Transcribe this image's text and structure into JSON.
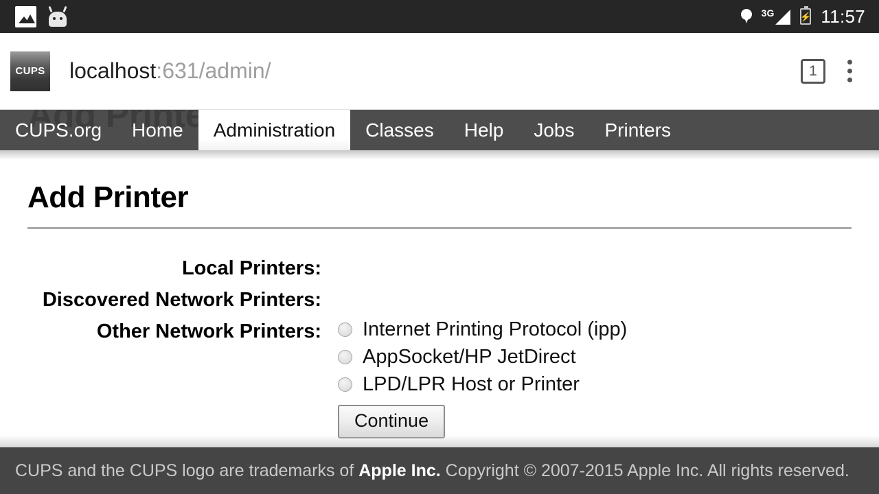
{
  "status_bar": {
    "icons_left": [
      "gallery-icon",
      "android-head-icon"
    ],
    "location_icon": "location-pin-icon",
    "network_label": "3G",
    "signal_icon": "signal-bars-icon",
    "battery_icon": "battery-charging-icon",
    "battery_glyph": "⚡",
    "time": "11:57"
  },
  "browser": {
    "favicon_label": "CUPS",
    "url_host": "localhost",
    "url_path": ":631/admin/",
    "tab_count": "1",
    "overflow_icon": "three-dot-menu-icon"
  },
  "site": {
    "bleed_title": "Add Printer",
    "nav": [
      {
        "label": "CUPS.org",
        "active": false
      },
      {
        "label": "Home",
        "active": false
      },
      {
        "label": "Administration",
        "active": true
      },
      {
        "label": "Classes",
        "active": false
      },
      {
        "label": "Help",
        "active": false
      },
      {
        "label": "Jobs",
        "active": false
      },
      {
        "label": "Printers",
        "active": false
      }
    ]
  },
  "main": {
    "page_title": "Add Printer",
    "rows": [
      {
        "label": "Local Printers:",
        "options": []
      },
      {
        "label": "Discovered Network Printers:",
        "options": []
      },
      {
        "label": "Other Network Printers:",
        "options": [
          {
            "value": "ipp",
            "label": "Internet Printing Protocol (ipp)",
            "checked": false
          },
          {
            "value": "socket",
            "label": "AppSocket/HP JetDirect",
            "checked": false
          },
          {
            "value": "lpd",
            "label": "LPD/LPR Host or Printer",
            "checked": false
          }
        ]
      }
    ],
    "continue_label": "Continue"
  },
  "footer": {
    "text_before": "CUPS and the CUPS logo are trademarks of ",
    "link": "Apple Inc.",
    "text_after": " Copyright © 2007-2015 Apple Inc. All rights reserved."
  },
  "colors": {
    "status_bar_bg": "#262626",
    "nav_bg": "#404040",
    "footer_bg": "#454545",
    "rule": "#a8a8a8",
    "url_path": "#9e9e9e"
  }
}
